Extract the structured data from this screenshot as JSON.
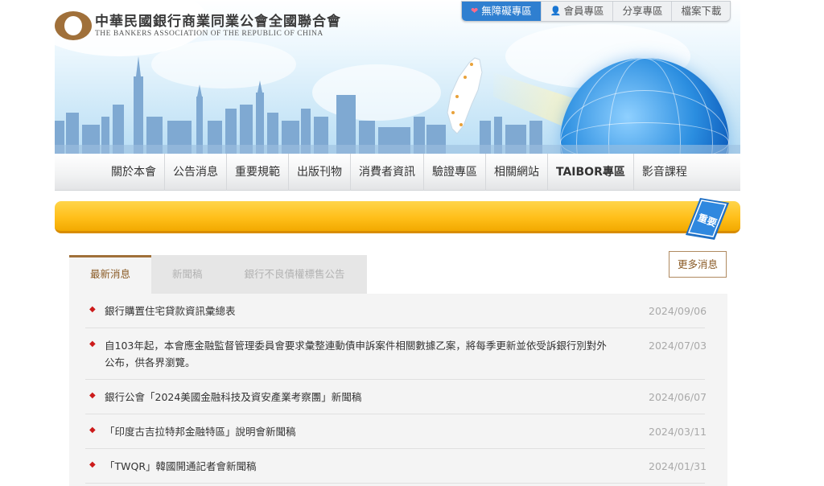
{
  "logo": {
    "name_cn": "中華民國銀行商業同業公會全國聯合會",
    "name_en": "THE BANKERS ASSOCIATION OF THE REPUBLIC OF CHINA"
  },
  "toplinks": [
    {
      "label": "無障礙專區",
      "icon": "heart-icon"
    },
    {
      "label": "會員專區",
      "icon": "person-icon"
    },
    {
      "label": "分享專區"
    },
    {
      "label": "檔案下載"
    }
  ],
  "nav": [
    "關於本會",
    "公告消息",
    "重要規範",
    "出版刊物",
    "消費者資訊",
    "驗證專區",
    "相關網站",
    "TAIBOR專區",
    "影音課程"
  ],
  "marquee": {
    "ribbon_label": "重要"
  },
  "news": {
    "tabs": [
      "最新消息",
      "新聞稿",
      "銀行不良債權標售公告"
    ],
    "more_label": "更多消息",
    "items": [
      {
        "title": "銀行購置住宅貸款資訊彙總表",
        "date": "2024/09/06"
      },
      {
        "title": "自103年起，本會應金融監督管理委員會要求彙整連動債申訴案件相關數據乙案，將每季更新並依受訴銀行別對外公布，供各界瀏覽。",
        "date": "2024/07/03"
      },
      {
        "title": "銀行公會「2024美國金融科技及資安產業考察團」新聞稿",
        "date": "2024/06/07"
      },
      {
        "title": "「印度古吉拉特邦金融特區」說明會新聞稿",
        "date": "2024/03/11"
      },
      {
        "title": "「TWQR」韓國開通記者會新聞稿",
        "date": "2024/01/31"
      }
    ]
  },
  "colors": {
    "accent_brown": "#a0703a",
    "accessible_blue": "#2f7fd0",
    "marquee_yellow": "#ffbf1a",
    "bullet_red": "#cc1a1a"
  }
}
